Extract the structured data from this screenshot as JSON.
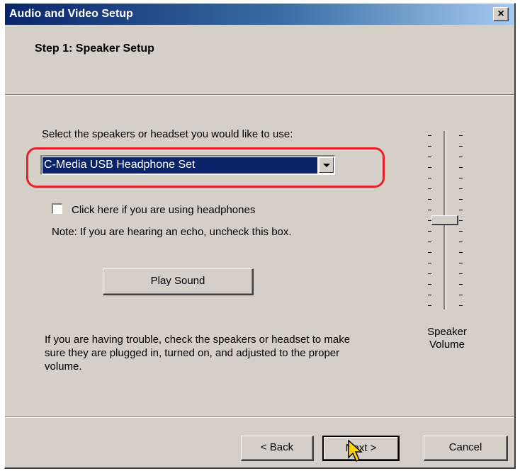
{
  "window": {
    "title": "Audio and Video Setup",
    "close_icon": "close-icon",
    "close_glyph": "×"
  },
  "step": {
    "title": "Step 1: Speaker Setup"
  },
  "speaker_select": {
    "label": "Select the speakers or headset you would like to use:",
    "selected_value": "C-Media USB Headphone Set",
    "highlight_color": "#e8202a"
  },
  "headphones_checkbox": {
    "label": "Click here if you are using headphones",
    "checked": false
  },
  "note": "Note: If you are hearing an echo, uncheck this box.",
  "play_sound_button": "Play Sound",
  "help_text": "If you are having trouble, check the speakers or headset to make sure they are plugged in, turned on, and adjusted to the proper volume.",
  "volume": {
    "label_line1": "Speaker",
    "label_line2": "Volume",
    "level_fraction": 0.5
  },
  "buttons": {
    "back": "< Back",
    "next": "Next >",
    "cancel": "Cancel"
  },
  "colors": {
    "titlebar_start": "#0a246a",
    "titlebar_end": "#a6caf0",
    "dialog_face": "#d4d0c8",
    "selection": "#0a246a"
  }
}
